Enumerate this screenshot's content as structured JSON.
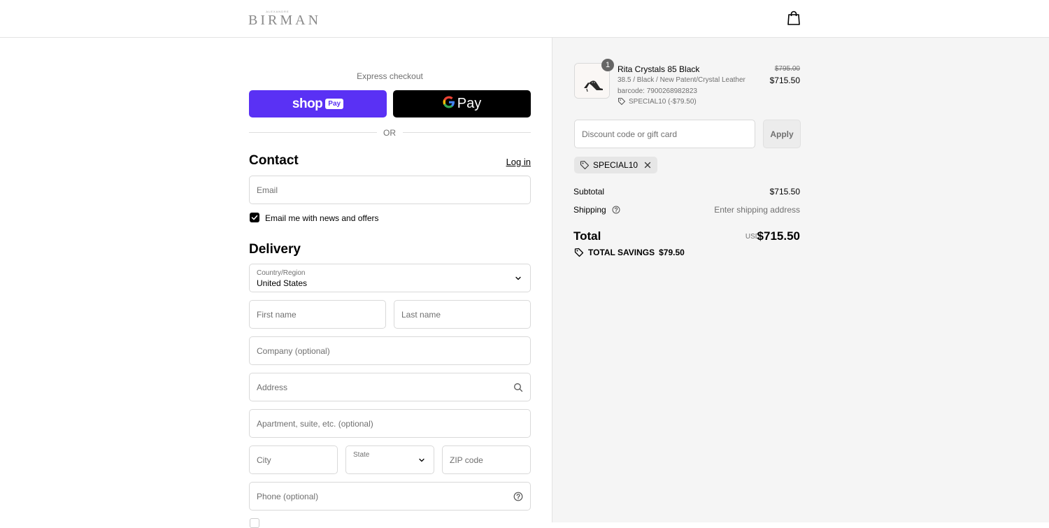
{
  "header": {
    "logo_tagline": "ALEXANDRE",
    "logo": "BIRMAN",
    "cart_icon": "shopping-bag-icon"
  },
  "express": {
    "title": "Express checkout",
    "shop_pay_label": "shop",
    "shop_pay_badge": "Pay",
    "gpay_g": "G",
    "gpay_label": "Pay",
    "or": "OR"
  },
  "contact": {
    "title": "Contact",
    "login": "Log in",
    "email_placeholder": "Email",
    "newsletter_label": "Email me with news and offers",
    "newsletter_checked": true
  },
  "delivery": {
    "title": "Delivery",
    "country_label": "Country/Region",
    "country_value": "United States",
    "first_name": "First name",
    "last_name": "Last name",
    "company": "Company (optional)",
    "address": "Address",
    "apartment": "Apartment, suite, etc. (optional)",
    "city": "City",
    "state": "State",
    "zip": "ZIP code",
    "phone": "Phone (optional)"
  },
  "order": {
    "quantity": "1",
    "product_name": "Rita Crystals 85 Black",
    "variant": "38.5 / Black / New Patent/Crystal Leather",
    "barcode": "barcode: 7900268982823",
    "discount_line": "SPECIAL10 (-$79.50)",
    "price_original": "$795.00",
    "price_final": "$715.50",
    "discount_placeholder": "Discount code or gift card",
    "apply": "Apply",
    "applied_code": "SPECIAL10",
    "subtotal_label": "Subtotal",
    "subtotal_value": "$715.50",
    "shipping_label": "Shipping",
    "shipping_value": "Enter shipping address",
    "total_label": "Total",
    "currency": "USD",
    "total_value": "$715.50",
    "savings_label": "TOTAL SAVINGS",
    "savings_value": "$79.50"
  },
  "colors": {
    "shop_pay": "#5a31f4",
    "gpay": "#000000",
    "summary_bg": "#f5f5f5"
  }
}
